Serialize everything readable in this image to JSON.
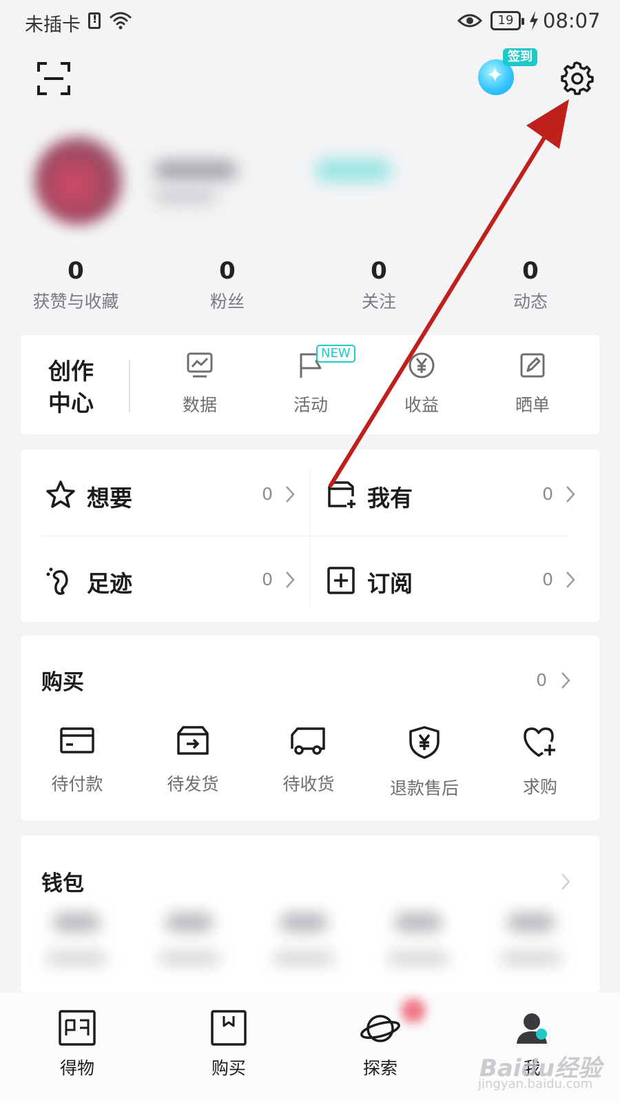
{
  "status_bar": {
    "carrier": "未插卡",
    "battery": "19",
    "time": "08:07"
  },
  "header": {
    "signin_badge": "签到"
  },
  "stats": [
    {
      "value": "0",
      "label": "获赞与收藏"
    },
    {
      "value": "0",
      "label": "粉丝"
    },
    {
      "value": "0",
      "label": "关注"
    },
    {
      "value": "0",
      "label": "动态"
    }
  ],
  "creator": {
    "title": "创作中心",
    "tools": [
      {
        "label": "数据",
        "icon": "chart-monitor-icon"
      },
      {
        "label": "活动",
        "icon": "flag-icon",
        "badge": "NEW"
      },
      {
        "label": "收益",
        "icon": "yen-coin-icon"
      },
      {
        "label": "晒单",
        "icon": "edit-note-icon"
      }
    ]
  },
  "collections": [
    {
      "label": "想要",
      "count": "0",
      "icon": "star-icon"
    },
    {
      "label": "我有",
      "count": "0",
      "icon": "box-add-icon"
    },
    {
      "label": "足迹",
      "count": "0",
      "icon": "footprint-icon"
    },
    {
      "label": "订阅",
      "count": "0",
      "icon": "plus-square-icon"
    }
  ],
  "purchase": {
    "title": "购买",
    "count": "0",
    "orders": [
      {
        "label": "待付款",
        "icon": "card-icon"
      },
      {
        "label": "待发货",
        "icon": "box-out-icon"
      },
      {
        "label": "待收货",
        "icon": "truck-icon"
      },
      {
        "label": "退款售后",
        "icon": "shield-yen-icon"
      },
      {
        "label": "求购",
        "icon": "heart-plus-icon"
      }
    ]
  },
  "wallet": {
    "title": "钱包"
  },
  "tabbar": [
    {
      "label": "得物",
      "icon": "dewu-logo-icon"
    },
    {
      "label": "购买",
      "icon": "shopping-bag-icon"
    },
    {
      "label": "探索",
      "icon": "planet-icon"
    },
    {
      "label": "我",
      "icon": "profile-icon",
      "active": true
    }
  ],
  "annotation": {
    "arrow_color": "#c0201c"
  },
  "watermark": {
    "text": "Baidu经验",
    "sub": "jingyan.baidu.com"
  },
  "colors": {
    "accent": "#20c9c7",
    "background": "#f4f4f6"
  }
}
